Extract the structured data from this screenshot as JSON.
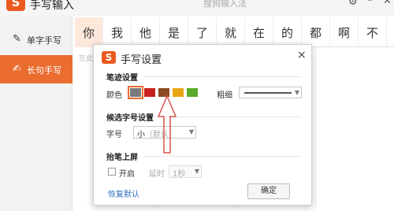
{
  "app": {
    "title": "手写输入",
    "faded_title": "搜狗输入法",
    "logo_glyph": "S"
  },
  "sidebar": {
    "items": [
      {
        "label": "单字手写",
        "active": false
      },
      {
        "label": "长句手写",
        "active": true
      }
    ],
    "accent_color": "#ea6c2f"
  },
  "candidates": [
    "你",
    "我",
    "他",
    "是",
    "了",
    "就",
    "在",
    "的",
    "都",
    "啊",
    "不"
  ],
  "writing_area": {
    "hint": "在此"
  },
  "dialog": {
    "title": "手写设置",
    "close_glyph": "×",
    "stroke_section": {
      "title": "笔迹设置",
      "color_label": "颜色",
      "colors": [
        "#7a7a7a",
        "#c8201c",
        "#8b4a23",
        "#e8a614",
        "#5aac2a"
      ],
      "selected_color_index": 0,
      "thickness_label": "粗细"
    },
    "font_section": {
      "title": "候选字号设置",
      "size_label": "字号",
      "size_value": "小",
      "size_default": "（默认）"
    },
    "lift_section": {
      "title": "抬笔上屏",
      "enable_label": "开启",
      "enabled": false,
      "delay_label": "延时",
      "delay_value": "1秒"
    },
    "restore_label": "恢复默认",
    "ok_label": "确定"
  },
  "annotation": {
    "type": "up-arrow",
    "color": "#d9534f"
  }
}
